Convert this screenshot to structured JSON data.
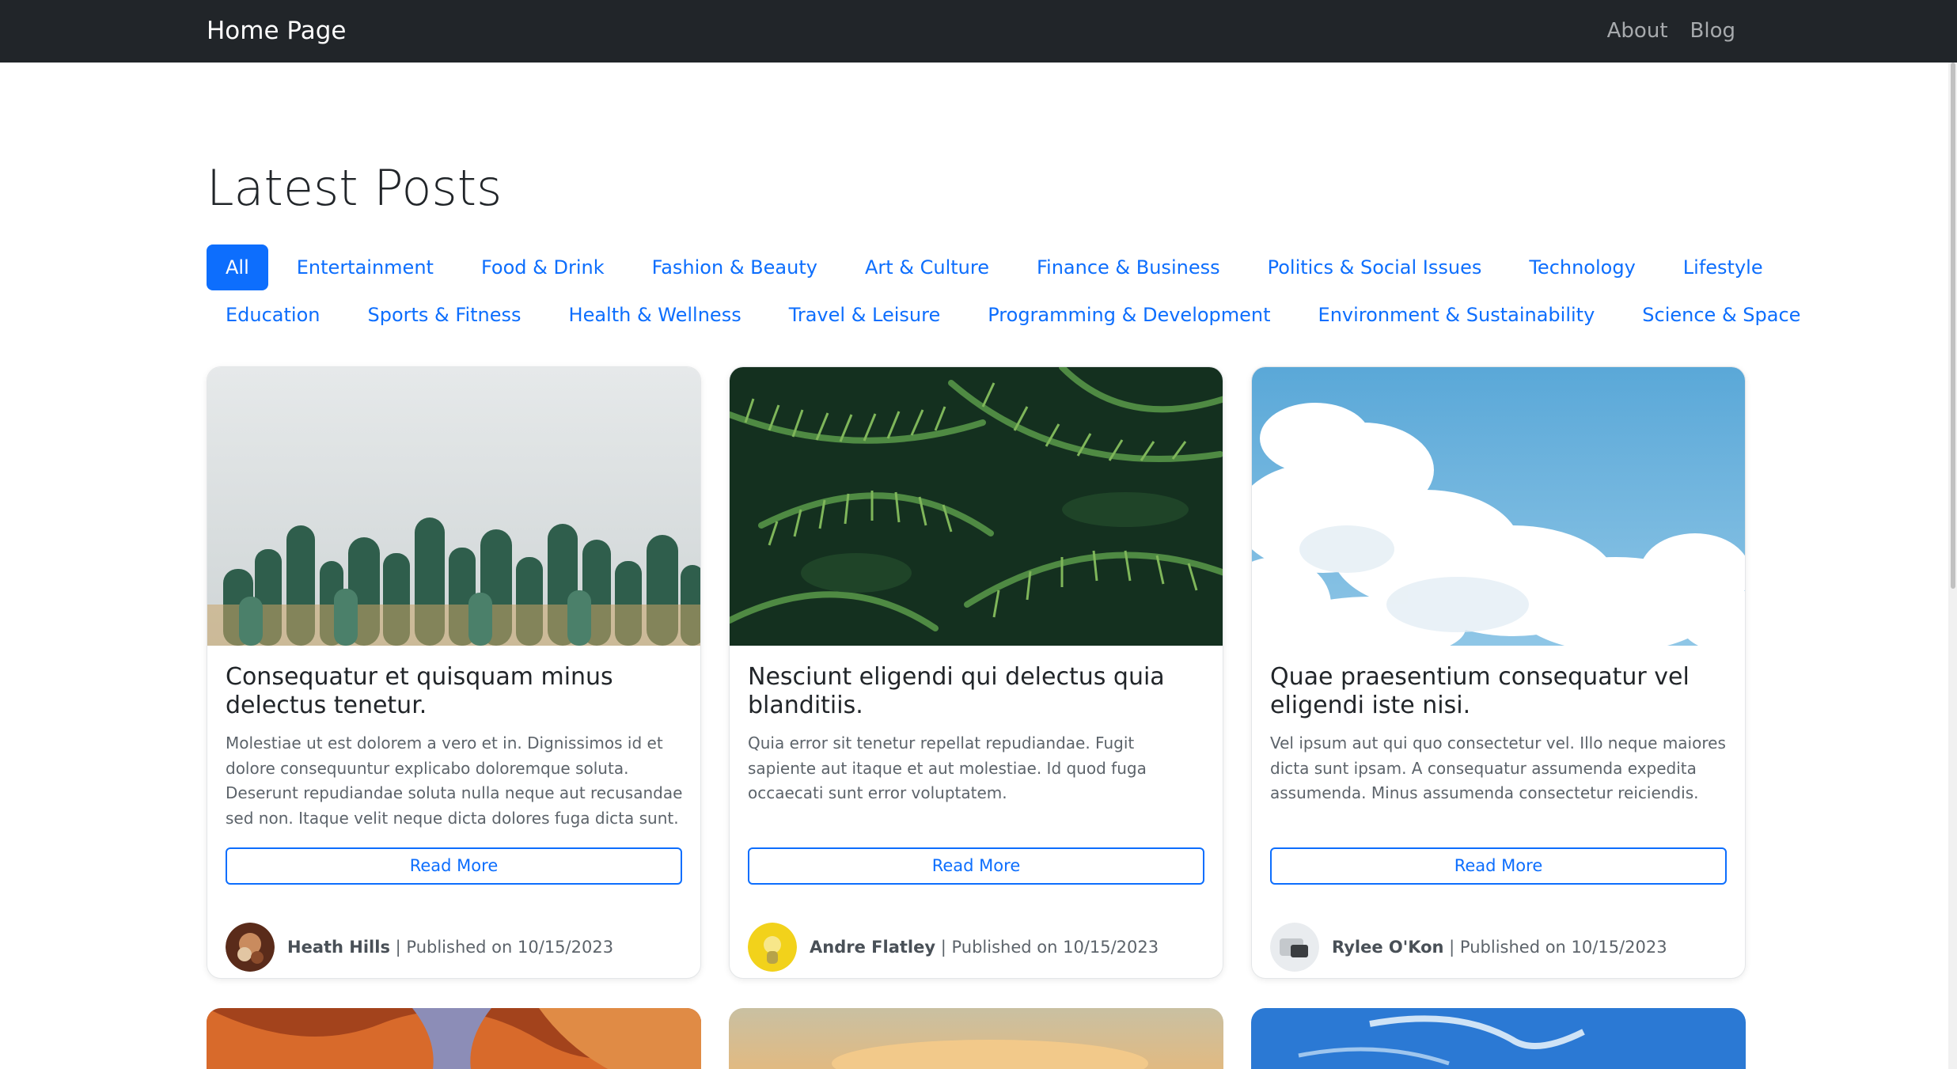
{
  "nav": {
    "brand": "Home Page",
    "links": [
      "About",
      "Blog"
    ]
  },
  "main": {
    "title": "Latest Posts",
    "filters": [
      "All",
      "Entertainment",
      "Food & Drink",
      "Fashion & Beauty",
      "Art & Culture",
      "Finance & Business",
      "Politics & Social Issues",
      "Technology",
      "Lifestyle",
      "Education",
      "Sports & Fitness",
      "Health & Wellness",
      "Travel & Leisure",
      "Programming & Development",
      "Environment & Sustainability",
      "Science & Space"
    ],
    "active_filter": "All"
  },
  "posts": [
    {
      "title": "Consequatur et quisquam minus delectus tenetur.",
      "excerpt": "Molestiae ut est dolorem a vero et in. Dignissimos id et dolore consequuntur explicabo doloremque soluta. Deserunt repudiandae soluta nulla neque aut recusandae sed non. Itaque velit neque dicta dolores fuga dicta sunt.",
      "button": "Read More",
      "author": "Heath Hills",
      "published": "| Published on 10/15/2023"
    },
    {
      "title": "Nesciunt eligendi qui delectus quia blanditiis.",
      "excerpt": "Quia error sit tenetur repellat repudiandae. Fugit sapiente aut itaque et aut molestiae. Id quod fuga occaecati sunt error voluptatem.",
      "button": "Read More",
      "author": "Andre Flatley",
      "published": "| Published on 10/15/2023"
    },
    {
      "title": "Quae praesentium consequatur vel eligendi iste nisi.",
      "excerpt": "Vel ipsum aut qui quo consectetur vel. Illo neque maiores dicta sunt ipsam. A consequatur assumenda expedita assumenda. Minus assumenda consectetur reiciendis.",
      "button": "Read More",
      "author": "Rylee O'Kon",
      "published": "| Published on 10/15/2023"
    }
  ],
  "colors": {
    "navbar": "#212529",
    "accent": "#0d6efd",
    "muted_text": "#5c636a"
  }
}
